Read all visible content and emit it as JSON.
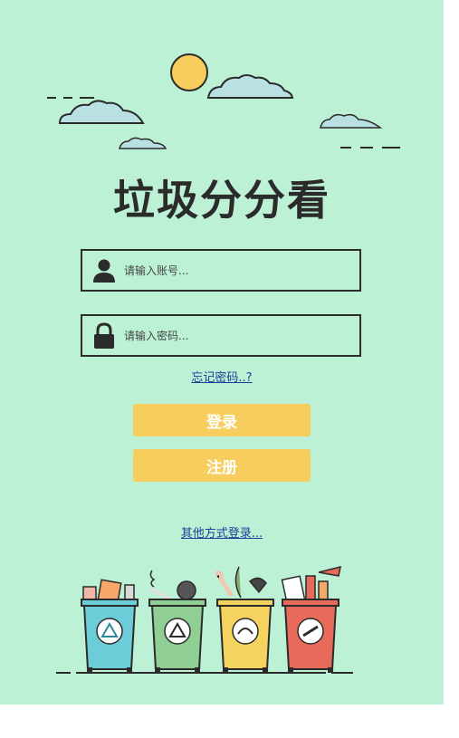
{
  "app": {
    "title": "垃圾分分看"
  },
  "form": {
    "username_placeholder": "请输入账号...",
    "password_placeholder": "请输入密码...",
    "forgot_password": "忘记密码..?",
    "login_label": "登录",
    "register_label": "注册",
    "other_login": "其他方式登录..."
  },
  "colors": {
    "background": "#bdf1d6",
    "button": "#f7ce5d",
    "link": "#1b3f99",
    "bin_recyclable": "#6ccdd8",
    "bin_hazardous_green": "#8fcf94",
    "bin_kitchen": "#f4d35e",
    "bin_other": "#e86a5b"
  },
  "icons": [
    "sun-icon",
    "cloud-icon",
    "user-icon",
    "lock-icon",
    "trash-bins-illustration"
  ]
}
